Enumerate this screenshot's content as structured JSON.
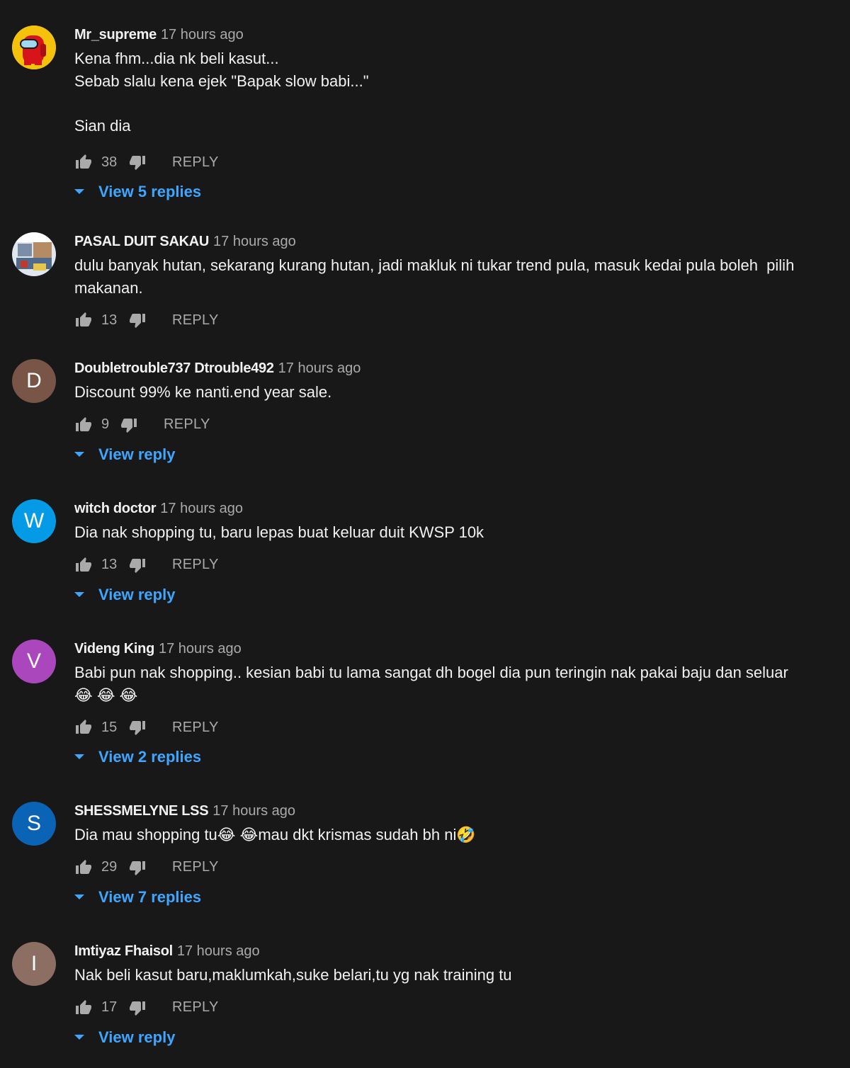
{
  "comments": [
    {
      "author": "Mr_supreme",
      "time": "17 hours ago",
      "text": "Kena fhm...dia nk beli kasut...\nSebab slalu kena ejek \"Bapak slow babi...\"\n\nSian dia",
      "likes": "38",
      "reply_label": "REPLY",
      "view_replies": "View 5 replies",
      "avatar_icon": "among-us-character-icon",
      "avatar_color": "#f4c20d"
    },
    {
      "author": "PASAL DUIT SAKAU",
      "time": "17 hours ago",
      "text": "dulu banyak hutan, sekarang kurang hutan, jadi makluk ni tukar trend pula, masuk kedai pula boleh  pilih makanan.",
      "likes": "13",
      "reply_label": "REPLY",
      "view_replies": "",
      "avatar_icon": "channel-photo-icon",
      "avatar_color": "#8a9bb0"
    },
    {
      "author": "Doubletrouble737 Dtrouble492",
      "time": "17 hours ago",
      "text": "Discount 99% ke nanti.end year sale.",
      "likes": "9",
      "reply_label": "REPLY",
      "view_replies": "View reply",
      "avatar_letter": "D",
      "avatar_color": "#795548"
    },
    {
      "author": "witch doctor",
      "time": "17 hours ago",
      "text": "Dia nak shopping tu, baru lepas buat keluar duit KWSP 10k",
      "likes": "13",
      "reply_label": "REPLY",
      "view_replies": "View reply",
      "avatar_letter": "W",
      "avatar_color": "#039be5"
    },
    {
      "author": "Videng King",
      "time": "17 hours ago",
      "text": "Babi pun nak shopping.. kesian babi tu lama sangat dh bogel dia pun teringin nak pakai baju dan seluar 😂 😂 😂",
      "likes": "15",
      "reply_label": "REPLY",
      "view_replies": "View 2 replies",
      "avatar_letter": "V",
      "avatar_color": "#ab47bc"
    },
    {
      "author": "SHESSMELYNE LSS",
      "time": "17 hours ago",
      "text": "Dia mau shopping tu😂 😂mau dkt krismas sudah bh ni🤣",
      "likes": "29",
      "reply_label": "REPLY",
      "view_replies": "View 7 replies",
      "avatar_letter": "S",
      "avatar_color": "#0b63b6"
    },
    {
      "author": "Imtiyaz Fhaisol",
      "time": "17 hours ago",
      "text": "Nak beli kasut baru,maklumkah,suke belari,tu yg nak training tu",
      "likes": "17",
      "reply_label": "REPLY",
      "view_replies": "View reply",
      "avatar_letter": "I",
      "avatar_color": "#8d6e63"
    }
  ],
  "colors": {
    "background": "#181818",
    "link": "#3ea6ff",
    "secondary_text": "#aaaaaa",
    "primary_text": "#f1f1f1"
  }
}
